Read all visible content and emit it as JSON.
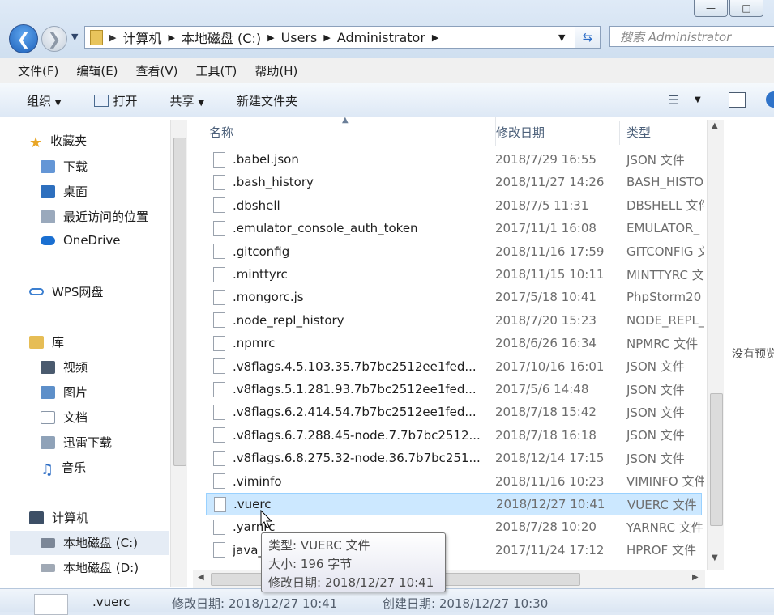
{
  "nav": {
    "address": [
      "计算机",
      "本地磁盘 (C:)",
      "Users",
      "Administrator"
    ],
    "search_placeholder": "搜索 Administrator"
  },
  "menu": [
    "文件(F)",
    "编辑(E)",
    "查看(V)",
    "工具(T)",
    "帮助(H)"
  ],
  "toolbar": {
    "organize": "组织",
    "open": "打开",
    "share": "共享",
    "new_folder": "新建文件夹"
  },
  "sidebar": {
    "favorites": "收藏夹",
    "favorites_items": [
      "下载",
      "桌面",
      "最近访问的位置",
      "OneDrive"
    ],
    "wps": "WPS网盘",
    "libraries": "库",
    "library_items": [
      "视频",
      "图片",
      "文档",
      "迅雷下载",
      "音乐"
    ],
    "computer": "计算机",
    "drives": [
      "本地磁盘 (C:)",
      "本地磁盘 (D:)"
    ]
  },
  "columns": {
    "name": "名称",
    "date": "修改日期",
    "type": "类型"
  },
  "files": [
    {
      "name": ".babel.json",
      "date": "2018/7/29 16:55",
      "type": "JSON 文件"
    },
    {
      "name": ".bash_history",
      "date": "2018/11/27 14:26",
      "type": "BASH_HISTO"
    },
    {
      "name": ".dbshell",
      "date": "2018/7/5 11:31",
      "type": "DBSHELL 文件"
    },
    {
      "name": ".emulator_console_auth_token",
      "date": "2017/11/1 16:08",
      "type": "EMULATOR_"
    },
    {
      "name": ".gitconfig",
      "date": "2018/11/16 17:59",
      "type": "GITCONFIG 文"
    },
    {
      "name": ".minttyrc",
      "date": "2018/11/15 10:11",
      "type": "MINTTYRC 文"
    },
    {
      "name": ".mongorc.js",
      "date": "2017/5/18 10:41",
      "type": "PhpStorm20"
    },
    {
      "name": ".node_repl_history",
      "date": "2018/7/20 15:23",
      "type": "NODE_REPL_"
    },
    {
      "name": ".npmrc",
      "date": "2018/6/26 16:34",
      "type": "NPMRC 文件"
    },
    {
      "name": ".v8flags.4.5.103.35.7b7bc2512ee1fed...",
      "date": "2017/10/16 16:01",
      "type": "JSON 文件"
    },
    {
      "name": ".v8flags.5.1.281.93.7b7bc2512ee1fed...",
      "date": "2017/5/6 14:48",
      "type": "JSON 文件"
    },
    {
      "name": ".v8flags.6.2.414.54.7b7bc2512ee1fed...",
      "date": "2018/7/18 15:42",
      "type": "JSON 文件"
    },
    {
      "name": ".v8flags.6.7.288.45-node.7.7b7bc2512...",
      "date": "2018/7/18 16:18",
      "type": "JSON 文件"
    },
    {
      "name": ".v8flags.6.8.275.32-node.36.7b7bc251...",
      "date": "2018/12/14 17:15",
      "type": "JSON 文件"
    },
    {
      "name": ".viminfo",
      "date": "2018/11/16 10:23",
      "type": "VIMINFO 文件"
    },
    {
      "name": ".vuerc",
      "date": "2018/12/27 10:41",
      "type": "VUERC 文件"
    },
    {
      "name": ".yarnrc",
      "date": "2018/7/28 10:20",
      "type": "YARNRC 文件"
    },
    {
      "name": "java_",
      "date": "2017/11/24 17:12",
      "type": "HPROF 文件"
    }
  ],
  "selected_index": 15,
  "tooltip": {
    "type": "类型: VUERC 文件",
    "size": "大小: 196 字节",
    "modified": "修改日期: 2018/12/27 10:41"
  },
  "preview_text": "没有预览",
  "status": {
    "name": ".vuerc",
    "modified": "修改日期: 2018/12/27 10:41",
    "created": "创建日期: 2018/12/27 10:30"
  }
}
